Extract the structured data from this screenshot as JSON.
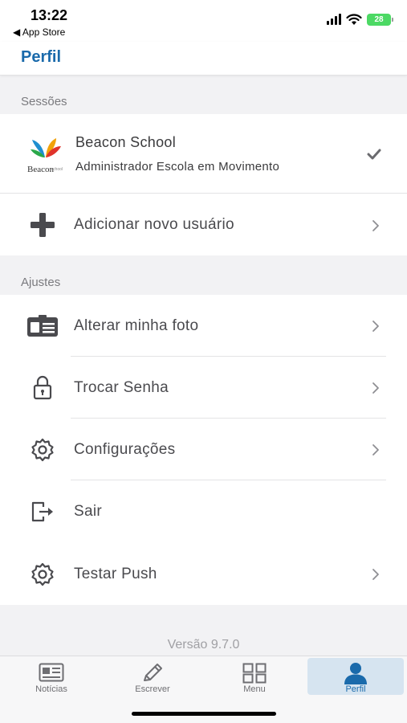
{
  "status_bar": {
    "time": "13:22",
    "back_app": "◀ App Store",
    "battery": "28"
  },
  "nav": {
    "title": "Perfil"
  },
  "sessions": {
    "header": "Sessões",
    "account": {
      "school": "Beacon School",
      "role": "Administrador Escola em Movimento",
      "logo_text": "Beacon",
      "logo_subtext": "school"
    },
    "add_user_label": "Adicionar novo usuário"
  },
  "settings": {
    "header": "Ajustes",
    "items": [
      {
        "label": "Alterar minha foto",
        "icon": "id-card-icon",
        "chevron": true
      },
      {
        "label": "Trocar Senha",
        "icon": "lock-icon",
        "chevron": true
      },
      {
        "label": "Configurações",
        "icon": "gear-icon",
        "chevron": true
      },
      {
        "label": "Sair",
        "icon": "logout-icon",
        "chevron": false
      },
      {
        "label": "Testar Push",
        "icon": "gear-icon",
        "chevron": true
      }
    ]
  },
  "version": "Versão 9.7.0",
  "tabbar": {
    "items": [
      {
        "label": "Notícias",
        "icon": "newspaper-icon",
        "active": false
      },
      {
        "label": "Escrever",
        "icon": "pencil-icon",
        "active": false
      },
      {
        "label": "Menu",
        "icon": "grid-icon",
        "active": false
      },
      {
        "label": "Perfil",
        "icon": "person-icon",
        "active": true
      }
    ]
  },
  "colors": {
    "accent": "#1a6aab",
    "background": "#f2f2f4",
    "active_tab_bg": "#d6e4f0"
  }
}
